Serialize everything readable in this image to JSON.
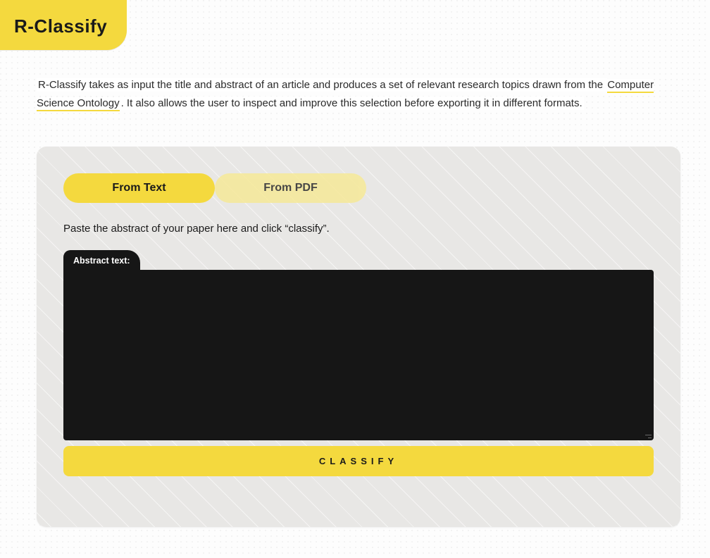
{
  "app": {
    "name": "R-Classify"
  },
  "intro": {
    "part1": "R-Classify takes as input the title and abstract of an article and produces a set of relevant research topics drawn from the ",
    "link_text": "Computer Science Ontology",
    "part2": ". It also allows the user to inspect and improve this selection before exporting it in different formats."
  },
  "tabs": [
    {
      "id": "from-text",
      "label": "From Text",
      "active": true
    },
    {
      "id": "from-pdf",
      "label": "From PDF",
      "active": false
    }
  ],
  "panel": {
    "instruction": "Paste the abstract of your paper here and click “classify”.",
    "field_label": "Abstract text:",
    "textarea_value": "",
    "textarea_placeholder": ""
  },
  "actions": {
    "classify_label": "CLASSIFY"
  }
}
